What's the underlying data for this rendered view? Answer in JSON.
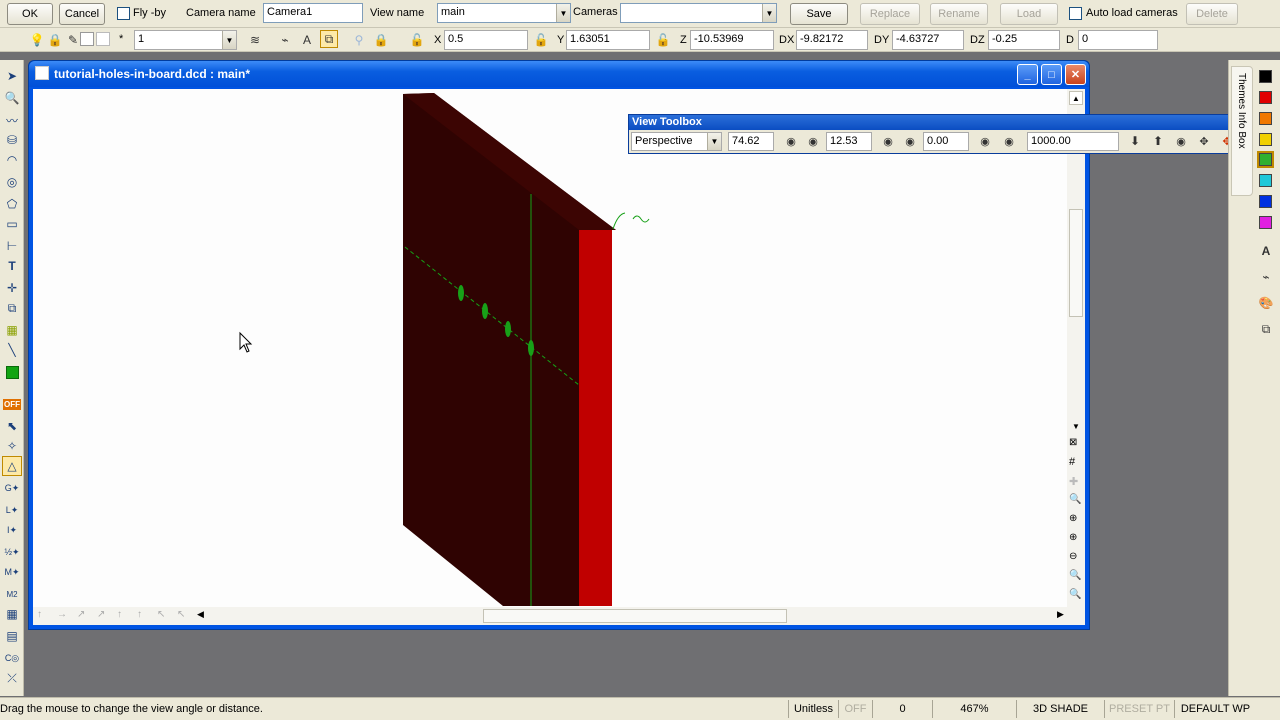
{
  "camera_bar": {
    "ok_label": "OK",
    "cancel_label": "Cancel",
    "flyby_label": "Fly -by",
    "camera_name_label": "Camera name",
    "camera_name_value": "Camera1",
    "view_name_label": "View name",
    "view_name_value": "main",
    "cameras_label": "Cameras",
    "cameras_value": "",
    "save_label": "Save",
    "replace_label": "Replace",
    "rename_label": "Rename",
    "load_label": "Load",
    "auto_load_label": "Auto load cameras",
    "delete_label": "Delete"
  },
  "coord_bar": {
    "layer_star": "*",
    "layer_value": "1",
    "x_label": "X",
    "x_value": "0.5",
    "y_label": "Y",
    "y_value": "1.63051",
    "z_label": "Z",
    "z_value": "-10.53969",
    "dx_label": "DX",
    "dx_value": "-9.82172",
    "dy_label": "DY",
    "dy_value": "-4.63727",
    "dz_label": "DZ",
    "dz_value": "-0.25",
    "d_label": "D",
    "d_value": "0"
  },
  "window": {
    "title": "tutorial-holes-in-board.dcd : main*"
  },
  "view_toolbox": {
    "title": "View Toolbox",
    "projection": "Perspective",
    "field1": "74.62",
    "field2": "12.53",
    "field3": "0.00",
    "field4": "1000.00"
  },
  "right_panel": {
    "tab_label": "Themes   Info Box",
    "colors": [
      "#000000",
      "#e00000",
      "#f07800",
      "#f0d000",
      "#30b030",
      "#20c8d8",
      "#0030e0",
      "#e020e0"
    ]
  },
  "status": {
    "hint": "Drag the mouse to change the view angle or distance.",
    "units": "Unitless",
    "off": "OFF",
    "count": "0",
    "zoom": "467%",
    "shade": "3D SHADE",
    "preset": "PRESET PT",
    "wp": "DEFAULT WP"
  }
}
